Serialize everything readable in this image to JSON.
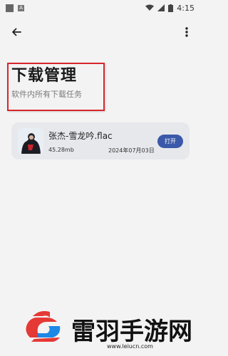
{
  "status_bar": {
    "notification_icons": [
      "square-icon",
      "a-icon"
    ],
    "a_badge": "A",
    "time": "4:15",
    "icons": [
      "wifi-icon",
      "signal-icon",
      "battery-icon"
    ]
  },
  "app_bar": {
    "back_icon": "arrow-left-icon",
    "menu_icon": "more-vert-icon"
  },
  "header": {
    "title": "下载管理",
    "subtitle": "软件内所有下载任务",
    "highlight_color": "#d9262d"
  },
  "downloads": [
    {
      "file_name": "张杰-雪龙吟.flac",
      "size": "45.28mb",
      "date": "2024年07月03日",
      "action_label": "打开",
      "action_color": "#3a59a8",
      "thumbnail_icon": "album-cover-thumbnail"
    }
  ],
  "watermark": {
    "name": "雷羽手游网",
    "url": "www.leiucn.com",
    "logo_colors": [
      "#e53935",
      "#1e88e5"
    ]
  }
}
